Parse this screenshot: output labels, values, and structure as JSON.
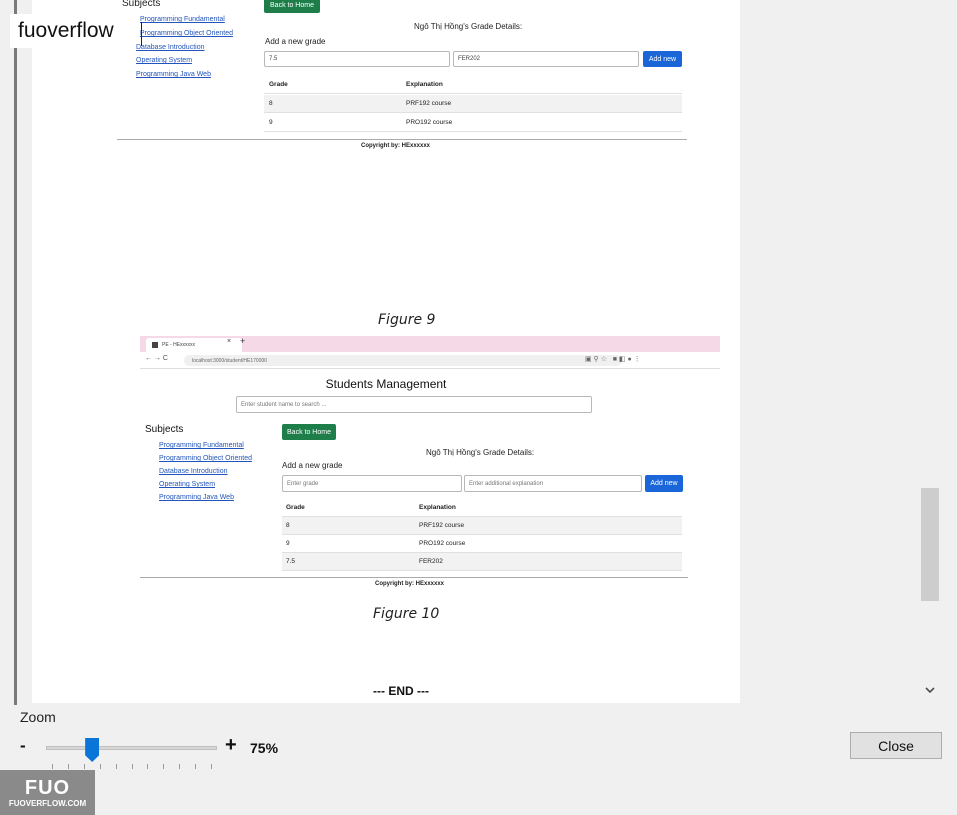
{
  "brand": {
    "label": "fuoverflow",
    "logo_mark": "FUO",
    "logo_text": "FUOVERFLOW.COM"
  },
  "figure9": {
    "subjects_title": "Subjects",
    "subjects": [
      "Programming Fundamental",
      "Programming Object Oriented",
      "Database Introduction",
      "Operating System",
      "Programming Java Web"
    ],
    "back_button": "Back to Home",
    "grade_title": "Ngô Thị Hồng's Grade Details:",
    "add_title": "Add a new grade",
    "grade_value": "7.5",
    "explanation_value": "FER202",
    "add_button": "Add new",
    "headers": [
      "Grade",
      "Explanation"
    ],
    "rows": [
      [
        "8",
        "PRF192 course"
      ],
      [
        "9",
        "PRO192 course"
      ]
    ],
    "copyright": "Copyright by: HExxxxxx",
    "caption": "Figure 9"
  },
  "figure10": {
    "tab_label": "PE - HExxxxxx",
    "url": "localhost:3000/student/HE170000",
    "page_title": "Students Management",
    "search_placeholder": "Enter student name to search ...",
    "subjects_title": "Subjects",
    "subjects": [
      "Programming Fundamental",
      "Programming Object Oriented",
      "Database Introduction",
      "Operating System",
      "Programming Java Web"
    ],
    "back_button": "Back to Home",
    "grade_title": "Ngô Thị Hồng's Grade Details:",
    "add_title": "Add a new grade",
    "grade_placeholder": "Enter grade",
    "explanation_placeholder": "Enter additional explanation",
    "add_button": "Add new",
    "headers": [
      "Grade",
      "Explanation"
    ],
    "rows": [
      [
        "8",
        "PRF192 course"
      ],
      [
        "9",
        "PRO192 course"
      ],
      [
        "7.5",
        "FER202"
      ]
    ],
    "copyright": "Copyright by: HExxxxxx",
    "caption": "Figure 10"
  },
  "end_text": "--- END ---",
  "zoom": {
    "label": "Zoom",
    "minus": "-",
    "plus": "+",
    "value_text": "75%",
    "level_fraction": 0.27
  },
  "close_button": "Close",
  "icons": {
    "scroll_down": "chevron-down-icon"
  }
}
